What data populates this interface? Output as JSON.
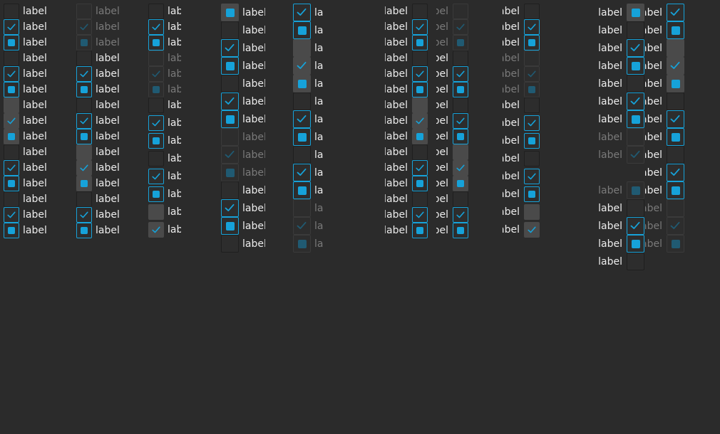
{
  "label_text": "label",
  "colors": {
    "background": "#2b2b2b",
    "accent": "#16a2d9",
    "text": "#ececec",
    "disabled_text": "#7a7a7a",
    "hover": "#4a4a4a"
  },
  "columns": [
    {
      "id": "c1",
      "label": "label",
      "states": [
        "u",
        "c",
        "i",
        "u",
        "c",
        "i",
        "uh",
        "ch",
        "ih",
        "u",
        "c",
        "i",
        "u",
        "c",
        "i"
      ]
    },
    {
      "id": "c2",
      "label": "label",
      "states": [
        "ud",
        "cd",
        "id",
        "u",
        "c",
        "i",
        "u",
        "c",
        "i",
        "uh",
        "ch",
        "ih",
        "u",
        "c",
        "i"
      ]
    },
    {
      "id": "c3",
      "label": "label",
      "states": [
        "u",
        "c",
        "i",
        "ud",
        "cd",
        "id",
        "u",
        "c",
        "i",
        "u",
        "c",
        "i",
        "uh",
        "ch"
      ]
    },
    {
      "id": "c4",
      "label": "label",
      "states": [
        "ih",
        "u",
        "c",
        "i",
        "u",
        "c",
        "i",
        "ud",
        "cd",
        "id",
        "u",
        "c",
        "i",
        "u"
      ]
    },
    {
      "id": "c5",
      "label": "label",
      "states": [
        "c",
        "i",
        "uh",
        "ch",
        "ih",
        "u",
        "c",
        "i",
        "u",
        "c",
        "i",
        "ud",
        "cd",
        "id"
      ]
    },
    {
      "id": "c6",
      "label": "label",
      "states": [
        "u",
        "c",
        "i",
        "u",
        "c",
        "i",
        "uh",
        "ch",
        "ih",
        "u",
        "c",
        "i",
        "u",
        "c",
        "i"
      ]
    },
    {
      "id": "c7",
      "label": "label",
      "states": [
        "ud",
        "cd",
        "id",
        "u",
        "c",
        "i",
        "u",
        "c",
        "i",
        "uh",
        "ch",
        "ih",
        "u",
        "c",
        "i"
      ]
    },
    {
      "id": "c8",
      "label": "label",
      "states": [
        "u",
        "c",
        "i",
        "ud",
        "cd",
        "id",
        "u",
        "c",
        "i",
        "u",
        "c",
        "i",
        "uh",
        "ch"
      ]
    },
    {
      "id": "c9",
      "label": "label",
      "states": [
        "ih",
        "u",
        "c",
        "i",
        "u",
        "c",
        "i",
        "ud",
        "cd",
        "id",
        "u",
        "c",
        "i",
        "u"
      ]
    },
    {
      "id": "c10",
      "label": "label",
      "states": [
        "c",
        "i",
        "uh",
        "ch",
        "ih",
        "u",
        "c",
        "i",
        "u",
        "c",
        "i",
        "ud",
        "cd",
        "id"
      ]
    }
  ]
}
